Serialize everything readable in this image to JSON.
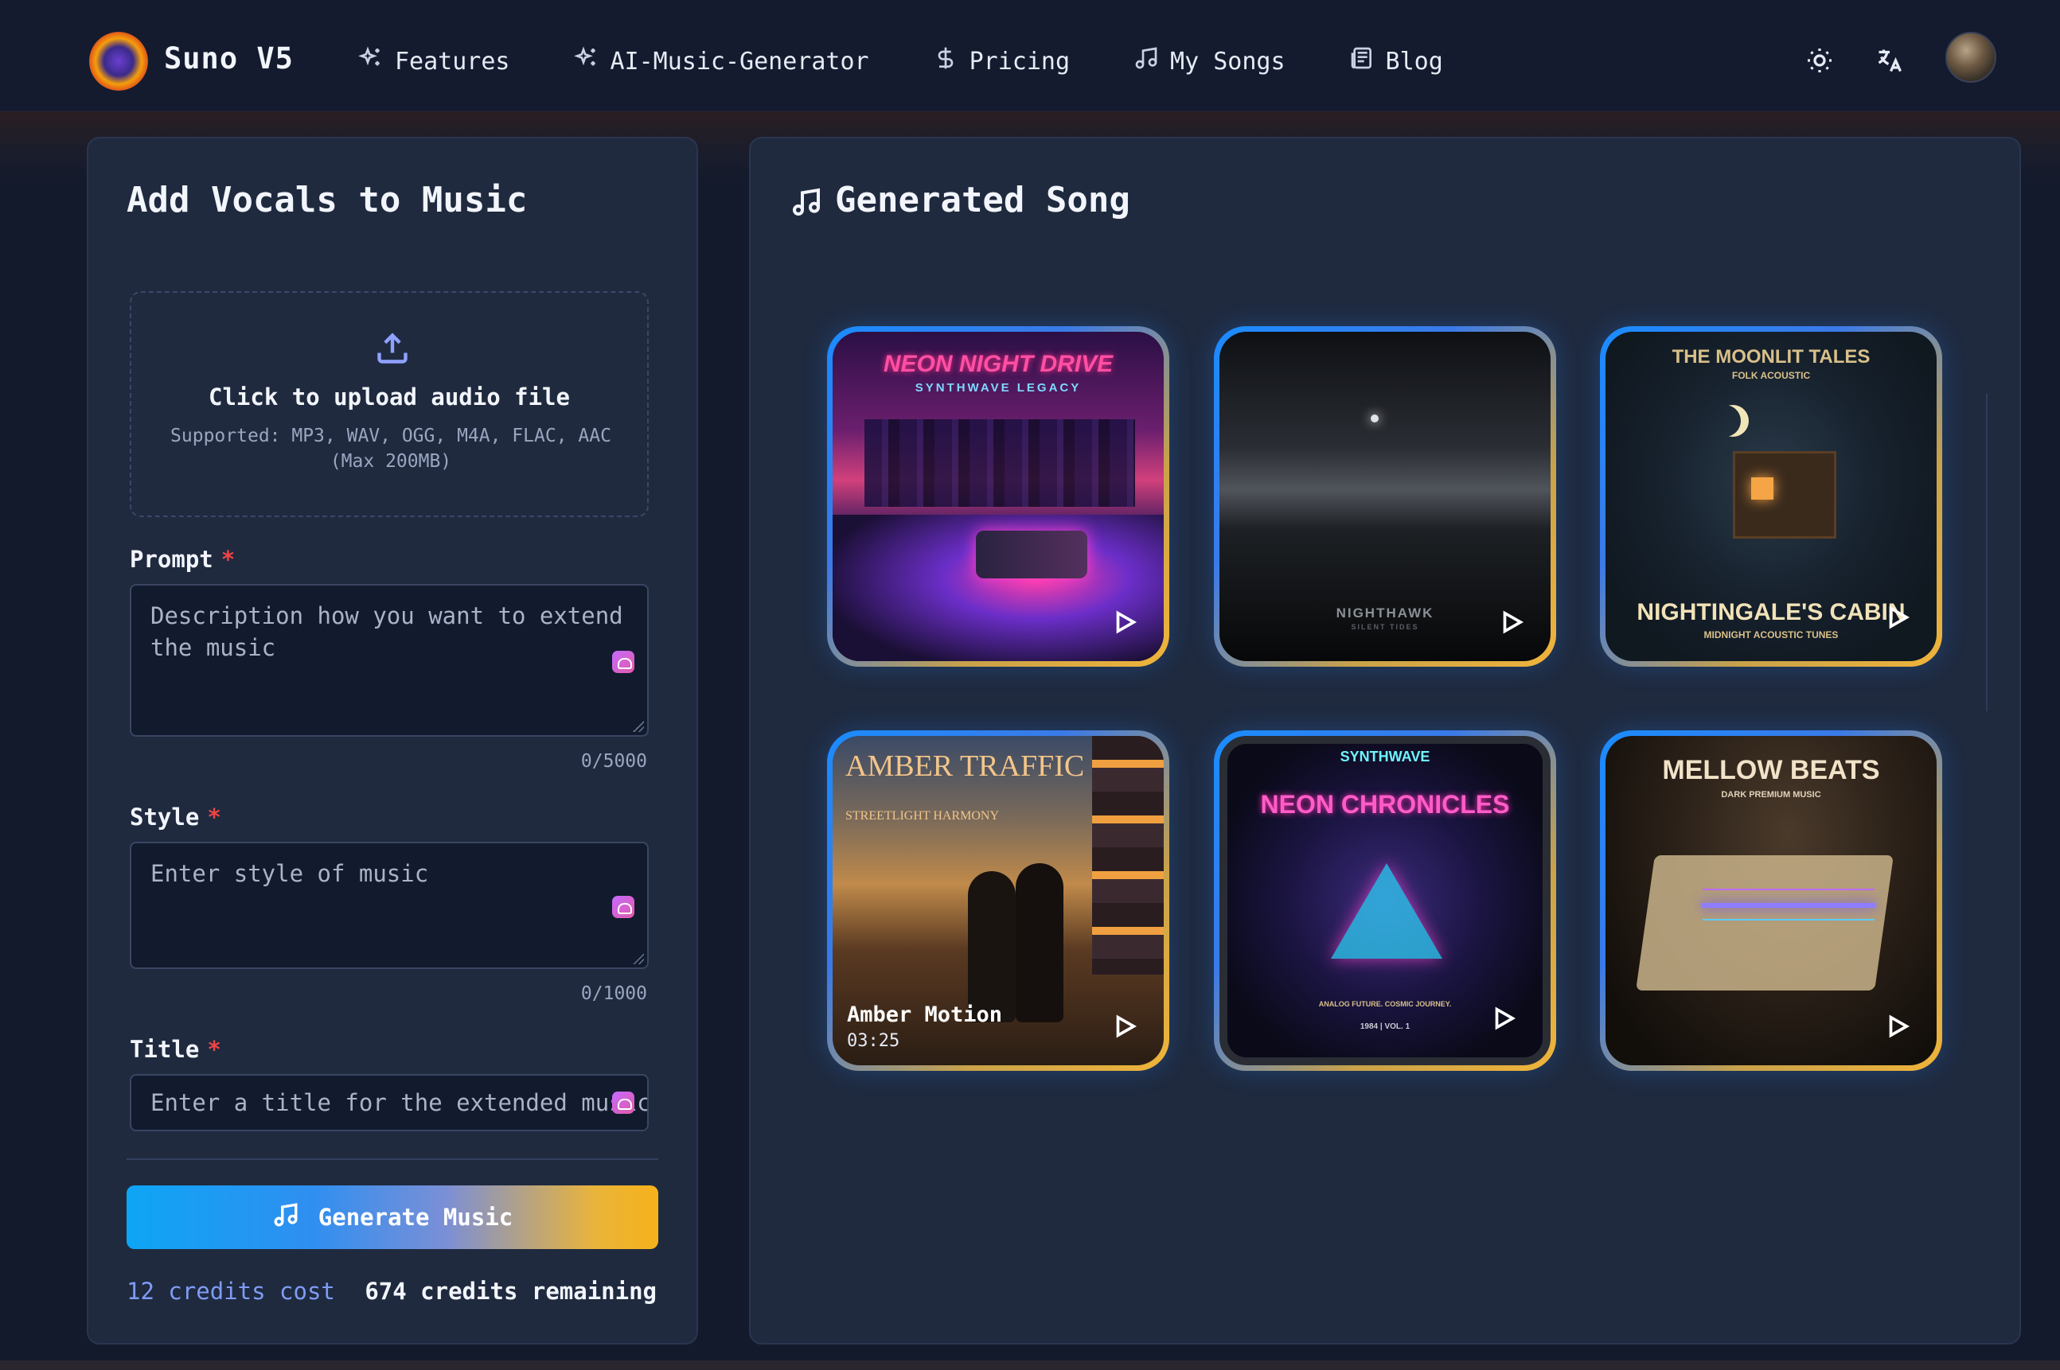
{
  "header": {
    "brand": "Suno V5",
    "nav": [
      {
        "label": "Features",
        "icon": "sparkles-icon"
      },
      {
        "label": "AI-Music-Generator",
        "icon": "sparkles-icon"
      },
      {
        "label": "Pricing",
        "icon": "dollar-icon"
      },
      {
        "label": "My Songs",
        "icon": "music-note-icon"
      },
      {
        "label": "Blog",
        "icon": "newspaper-icon"
      }
    ],
    "icons": [
      "sun-icon",
      "translate-icon",
      "avatar"
    ]
  },
  "form": {
    "title": "Add Vocals to Music",
    "upload": {
      "title": "Click to upload audio file",
      "subtitle": "Supported: MP3, WAV, OGG, M4A, FLAC, AAC (Max 200MB)"
    },
    "prompt": {
      "label": "Prompt",
      "required": "*",
      "placeholder": "Description how you want to extend the music",
      "counter": "0/5000"
    },
    "style": {
      "label": "Style",
      "required": "*",
      "placeholder": "Enter style of music",
      "counter": "0/1000"
    },
    "title_field": {
      "label": "Title",
      "required": "*",
      "placeholder": "Enter a title for the extended music"
    },
    "generate_label": "Generate Music",
    "credits_cost": "12 credits cost",
    "credits_remaining": "674 credits remaining"
  },
  "generated": {
    "title": "Generated Song",
    "cards": [
      {
        "art_title": "NEON NIGHT DRIVE",
        "art_sub": "SYNTHWAVE LEGACY"
      },
      {
        "art_title": "NIGHTHAWK",
        "art_sub": "SILENT TIDES"
      },
      {
        "art_title": "NIGHTINGALE'S CABIN",
        "art_top": "THE MOONLIT TALES",
        "art_top_sub": "FOLK ACOUSTIC",
        "art_sub": "MIDNIGHT ACOUSTIC TUNES"
      },
      {
        "art_title": "AMBER TRAFFIC",
        "art_sub": "STREETLIGHT HARMONY",
        "song_title": "Amber Motion",
        "duration": "03:25"
      },
      {
        "art_title": "NEON CHRONICLES",
        "art_top": "SYNTHWAVE",
        "art_sub": "ANALOG FUTURE. COSMIC JOURNEY.",
        "art_footer": "1984 | VOL. 1"
      },
      {
        "art_title": "MELLOW BEATS",
        "art_sub": "DARK PREMIUM MUSIC"
      }
    ]
  },
  "colors": {
    "background": "#131a2c",
    "panel": "#1f2a3f",
    "accent_blue": "#0ea5f5",
    "accent_gold": "#f7b21a",
    "required_red": "#ef4444",
    "credits_blue": "#7f9cf5"
  }
}
